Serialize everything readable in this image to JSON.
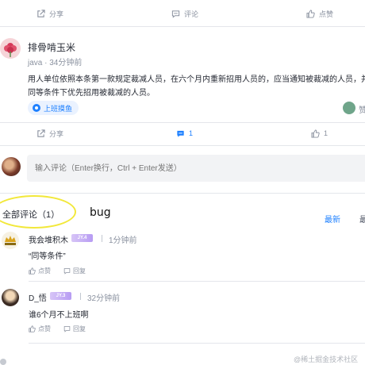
{
  "top_actions": {
    "share": "分享",
    "comment": "评论",
    "like": "点赞"
  },
  "post": {
    "author": "排骨啃玉米",
    "meta": "java · 34分钟前",
    "body_line1": "用人单位依照本条第一款规定裁减人员，在六个月内重新招用人员的，应当通知被裁减的人员，并",
    "body_line2": "同等条件下优先招用被裁减的人员。",
    "topic": "上班摸鱼",
    "right_label": "赞",
    "actions": {
      "share": "分享",
      "comment_count": "1",
      "like_count": "1"
    }
  },
  "comment_box": {
    "placeholder": "输入评论（Enter换行，Ctrl + Enter发送）"
  },
  "comments_header": {
    "title": "全部评论（1）",
    "annotation": "bug",
    "sort_new": "最新",
    "sort_hot": "最"
  },
  "comments": [
    {
      "name": "我会堆积木",
      "level": "JY.4",
      "time": "1分钟前",
      "text": "“同等条件”",
      "like": "点赞",
      "reply": "回复"
    },
    {
      "name": "D_悟",
      "level": "JY.3",
      "time": "32分钟前",
      "text": "谁6个月不上班啊",
      "like": "点赞",
      "reply": "回复"
    }
  ],
  "watermark": "@稀土掘金技术社区",
  "colors": {
    "accent": "#1e80ff",
    "muted": "#8a919f",
    "annotation_ring": "#f2e83a"
  }
}
